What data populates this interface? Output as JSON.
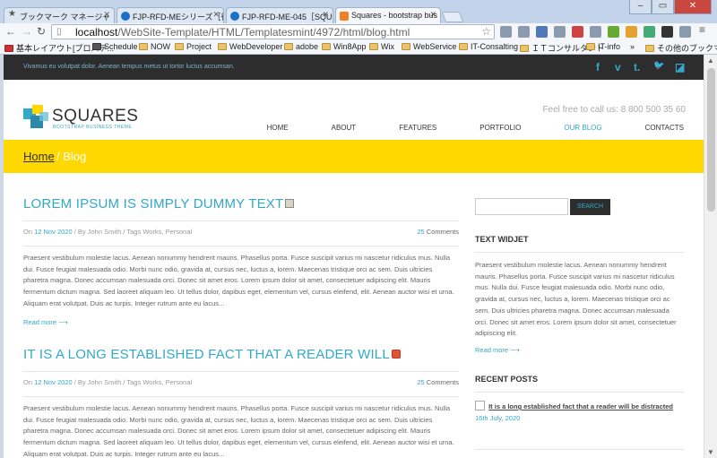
{
  "browser": {
    "tabs": [
      {
        "label": "ブックマーク マネージャ",
        "icon": "star-icon"
      },
      {
        "label": "FJP-RFD-MEシリーズ［従来",
        "icon": "globe-icon"
      },
      {
        "label": "FJP-RFD-ME-045［SQU",
        "icon": "globe-icon"
      },
      {
        "label": "Squares - bootstrap bus",
        "icon": "squares-favicon"
      }
    ],
    "url_host": "localhost",
    "url_path": "/WebSite-Template/HTML/Templatesmint/4972/html/blog.html",
    "bookmarks": [
      {
        "label": "基本レイアウト[プロパテ..."
      },
      {
        "label": "Schedule"
      },
      {
        "label": "NOW"
      },
      {
        "label": "Project"
      },
      {
        "label": "WebDeveloper"
      },
      {
        "label": "adobe"
      },
      {
        "label": "Win8App"
      },
      {
        "label": "Wix"
      },
      {
        "label": "WebService"
      },
      {
        "label": "IT-Consalting"
      },
      {
        "label": "ＩＴコンサルタント"
      },
      {
        "label": "IT-info"
      },
      {
        "label": "»"
      },
      {
        "label": "その他のブックマーク"
      }
    ]
  },
  "site": {
    "topbar_text": "Vivamus eu volutpat dolor. Aenean tempus metus ut tortor luctus accumsan.",
    "social": [
      {
        "icon": "facebook-icon",
        "glyph": "f"
      },
      {
        "icon": "vimeo-icon",
        "glyph": "v"
      },
      {
        "icon": "tumblr-icon",
        "glyph": "t."
      },
      {
        "icon": "twitter-icon",
        "glyph": "🐦"
      },
      {
        "icon": "delicious-icon",
        "glyph": "◪"
      }
    ],
    "brand": "SQUARES",
    "brand_sub": "BOOTSTRAP BUSINESS THEME",
    "callus": "Feel free to call us: 8 800 500 35 60",
    "nav": [
      "HOME",
      "ABOUT",
      "FEATURES",
      "PORTFOLIO",
      "OUR BLOG",
      "CONTACTS"
    ],
    "crumb_home": "Home",
    "crumb_rest": "/ Blog",
    "colors": {
      "accent": "#33a8c7",
      "yellow": "#ffd800",
      "dark": "#2d2d2d"
    }
  },
  "posts": [
    {
      "title": "LOREM IPSUM IS SIMPLY DUMMY TEXT",
      "on": "On ",
      "date": "12 Nov 2020",
      "by": " / By ",
      "author": "John Smith",
      "tags_label": " / Tags ",
      "tags": "Works, Personal",
      "comments_count": "25",
      "comments_label": " Comments",
      "body": "Praesent vestibulum molestie lacus. Aenean nonummy hendrerit mauris. Phasellus porta. Fusce suscipit varius mi nascetur ridiculus mus. Nulla dui. Fusce feugiat malesuada odio. Morbi nunc odio, gravida at, cursus nec, luctus a, lorem. Maecenas tristique orci ac sem. Duis ultricies pharetra magna. Donec accumsan malesuada orci. Donec sit amet eros. Lorem ipsum dolor sit amet, consectetuer adipiscing elit. Mauris fermentum dictum magna. Sed laoreet aliquam leo. Ut tellus dolor, dapibus eget, elementum vel, cursus eleifend, elit. Aenean auctor wisi et urna. Aliquam erat volutpat. Duis ac turpis. Integer rutrum ante eu lacus...",
      "read_more": "Read more ⟶"
    },
    {
      "title": "IT IS A LONG ESTABLISHED FACT THAT A READER WILL",
      "on": "On ",
      "date": "12 Nov 2020",
      "by": " / By ",
      "author": "John Smith",
      "tags_label": " / Tags ",
      "tags": "Works, Personal",
      "comments_count": "25",
      "comments_label": " Comments",
      "body": "Praesent vestibulum molestie lacus. Aenean nonummy hendrerit mauris. Phasellus porta. Fusce suscipit varius mi nascetur ridiculus mus. Nulla dui. Fusce feugiat malesuada odio. Morbi nunc odio, gravida at, cursus nec, luctus a, lorem. Maecenas tristique orci ac sem. Duis ultricies pharetra magna. Donec accumsan malesuada orci. Donec sit amet eros. Lorem ipsum dolor sit amet, consectetuer adipiscing elit. Mauris fermentum dictum magna. Sed laoreet aliquam leo. Ut tellus dolor, dapibus eget, elementum vel, cursus eleifend, elit. Aenean auctor wisi et urna. Aliquam erat volutpat. Duis ac turpis. Integer rutrum ante eu lacus..."
    }
  ],
  "sidebar": {
    "search_placeholder": "",
    "search_button": "SEARCH",
    "text_widget_title": "TEXT WIDJET",
    "text_widget_body": "Praesent vestibulum molestie lacus. Aenean nonummy hendrerit mauris. Phasellus porta. Fusce suscipit varius mi nascetur ridiculus mus. Nulla dui. Fusce feugiat malesuada odio. Morbi nunc odio, gravida at, cursus nec, luctus a, lorem. Maecenas tristique orci ac sem. Duis ultricies pharetra magna. Donec accumsan malesuada orci. Donec sit amet eros. Lorem ipsum dolor sit amet, consectetuer adipiscing elit.",
    "text_widget_more": "Read more ⟶",
    "recent_title": "RECENT POSTS",
    "recent": [
      {
        "title": "It is a long established fact that a reader will be distracted",
        "date": "16th July, 2020"
      }
    ]
  }
}
